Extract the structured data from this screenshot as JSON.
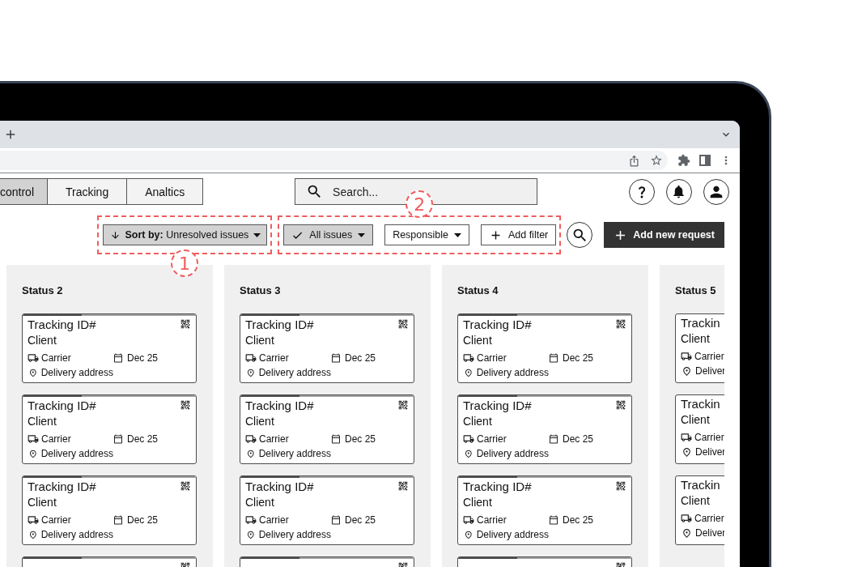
{
  "nav_tabs": [
    {
      "label": "control",
      "selected": true
    },
    {
      "label": "Tracking",
      "selected": false
    },
    {
      "label": "Analtics",
      "selected": false
    }
  ],
  "search": {
    "placeholder": "Search..."
  },
  "sort": {
    "label": "**Sort by:** Unresolved issues",
    "annotation": {
      "number": "1",
      "below": true
    }
  },
  "filters": {
    "annotation": {
      "number": "2",
      "below": false
    },
    "items": [
      {
        "kind": "dropdown",
        "label": "All issues",
        "selected": true
      },
      {
        "kind": "dropdown",
        "label": "Responsible",
        "selected": false
      },
      {
        "kind": "add",
        "label": "Add filter"
      }
    ]
  },
  "add_request_button": {
    "label": "Add new request"
  },
  "columns": [
    {
      "title": "Status 2",
      "cards": [
        {
          "title": "Tracking ID#",
          "qr_code": true,
          "client": "Client",
          "carrier": "Carrier",
          "date": "Dec 25",
          "address": "Delivery address",
          "level": 0.34
        },
        {
          "title": "Tracking ID#",
          "qr_code": true,
          "client": "Client",
          "carrier": "Carrier",
          "date": "Dec 25",
          "address": "Delivery address",
          "level": 0.34
        },
        {
          "title": "Tracking ID#",
          "qr_code": true,
          "client": "Client",
          "carrier": "Carrier",
          "date": "Dec 25",
          "address": "Delivery address",
          "level": 0.34
        },
        {
          "qr_code": true,
          "level": 0.34
        }
      ]
    },
    {
      "title": "Status 3",
      "cards": [
        {
          "title": "Tracking ID#",
          "qr_code": true,
          "client": "Client",
          "carrier": "Carrier",
          "date": "Dec 25",
          "address": "Delivery address",
          "level": 0.34
        },
        {
          "title": "Tracking ID#",
          "qr_code": true,
          "client": "Client",
          "carrier": "Carrier",
          "date": "Dec 25",
          "address": "Delivery address",
          "level": 0.34
        },
        {
          "title": "Tracking ID#",
          "qr_code": true,
          "client": "Client",
          "carrier": "Carrier",
          "date": "Dec 25",
          "address": "Delivery address",
          "level": 0.34
        },
        {
          "qr_code": true,
          "level": 0.34
        }
      ]
    },
    {
      "title": "Status 4",
      "cards": [
        {
          "title": "Tracking ID#",
          "qr_code": true,
          "client": "Client",
          "carrier": "Carrier",
          "date": "Dec 25",
          "address": "Delivery address",
          "level": 0.34
        },
        {
          "title": "Tracking ID#",
          "qr_code": true,
          "client": "Client",
          "carrier": "Carrier",
          "date": "Dec 25",
          "address": "Delivery address",
          "level": 0.34
        },
        {
          "title": "Tracking ID#",
          "qr_code": true,
          "client": "Client",
          "carrier": "Carrier",
          "date": "Dec 25",
          "address": "Delivery address",
          "level": 0.34
        },
        {
          "qr_code": true,
          "level": 0.34
        }
      ]
    },
    {
      "title": "Status 5",
      "cards": [
        {
          "title": "Trackin",
          "client": "Client",
          "carrier": "Carrier",
          "address": "Deliver"
        },
        {
          "title": "Trackin",
          "client": "Client",
          "carrier": "Carrier",
          "address": "Deliver"
        },
        {
          "title": "Trackin",
          "client": "Client",
          "carrier": "Carrier",
          "address": "Deliver"
        }
      ]
    }
  ]
}
